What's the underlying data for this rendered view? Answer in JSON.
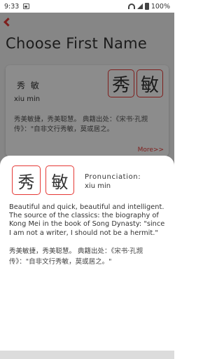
{
  "status_bar": {
    "time": "9:33",
    "battery": "100%"
  },
  "header": {
    "back_icon": "back-chevron-icon",
    "title": "Choose First Name"
  },
  "card": {
    "hanzi": "秀 敏",
    "pinyin": "xiu min",
    "chars": [
      "秀",
      "敏"
    ],
    "description": "秀美敏捷，秀美聪慧。 典籍出处：《宋书·孔觊传》：\"自非文行秀敏，莫或居之。",
    "more": "More>>"
  },
  "sheet": {
    "chars": [
      "秀",
      "敏"
    ],
    "pronunciation_label": "Pronunciation:",
    "pronunciation": "xiu min",
    "english": "Beautiful and quick, beautiful and intelligent. The source of the classics: the biography of Kong Mei in the book of Song Dynasty: \"since I am not a writer, I should not be a hermit.\"",
    "chinese": "秀美敏捷，秀美聪慧。 典籍出处：《宋书·孔觊传》：\"自非文行秀敏，莫或居之。\""
  },
  "colors": {
    "accent": "#e53935",
    "scrim": "rgba(0,0,0,0.45)"
  }
}
